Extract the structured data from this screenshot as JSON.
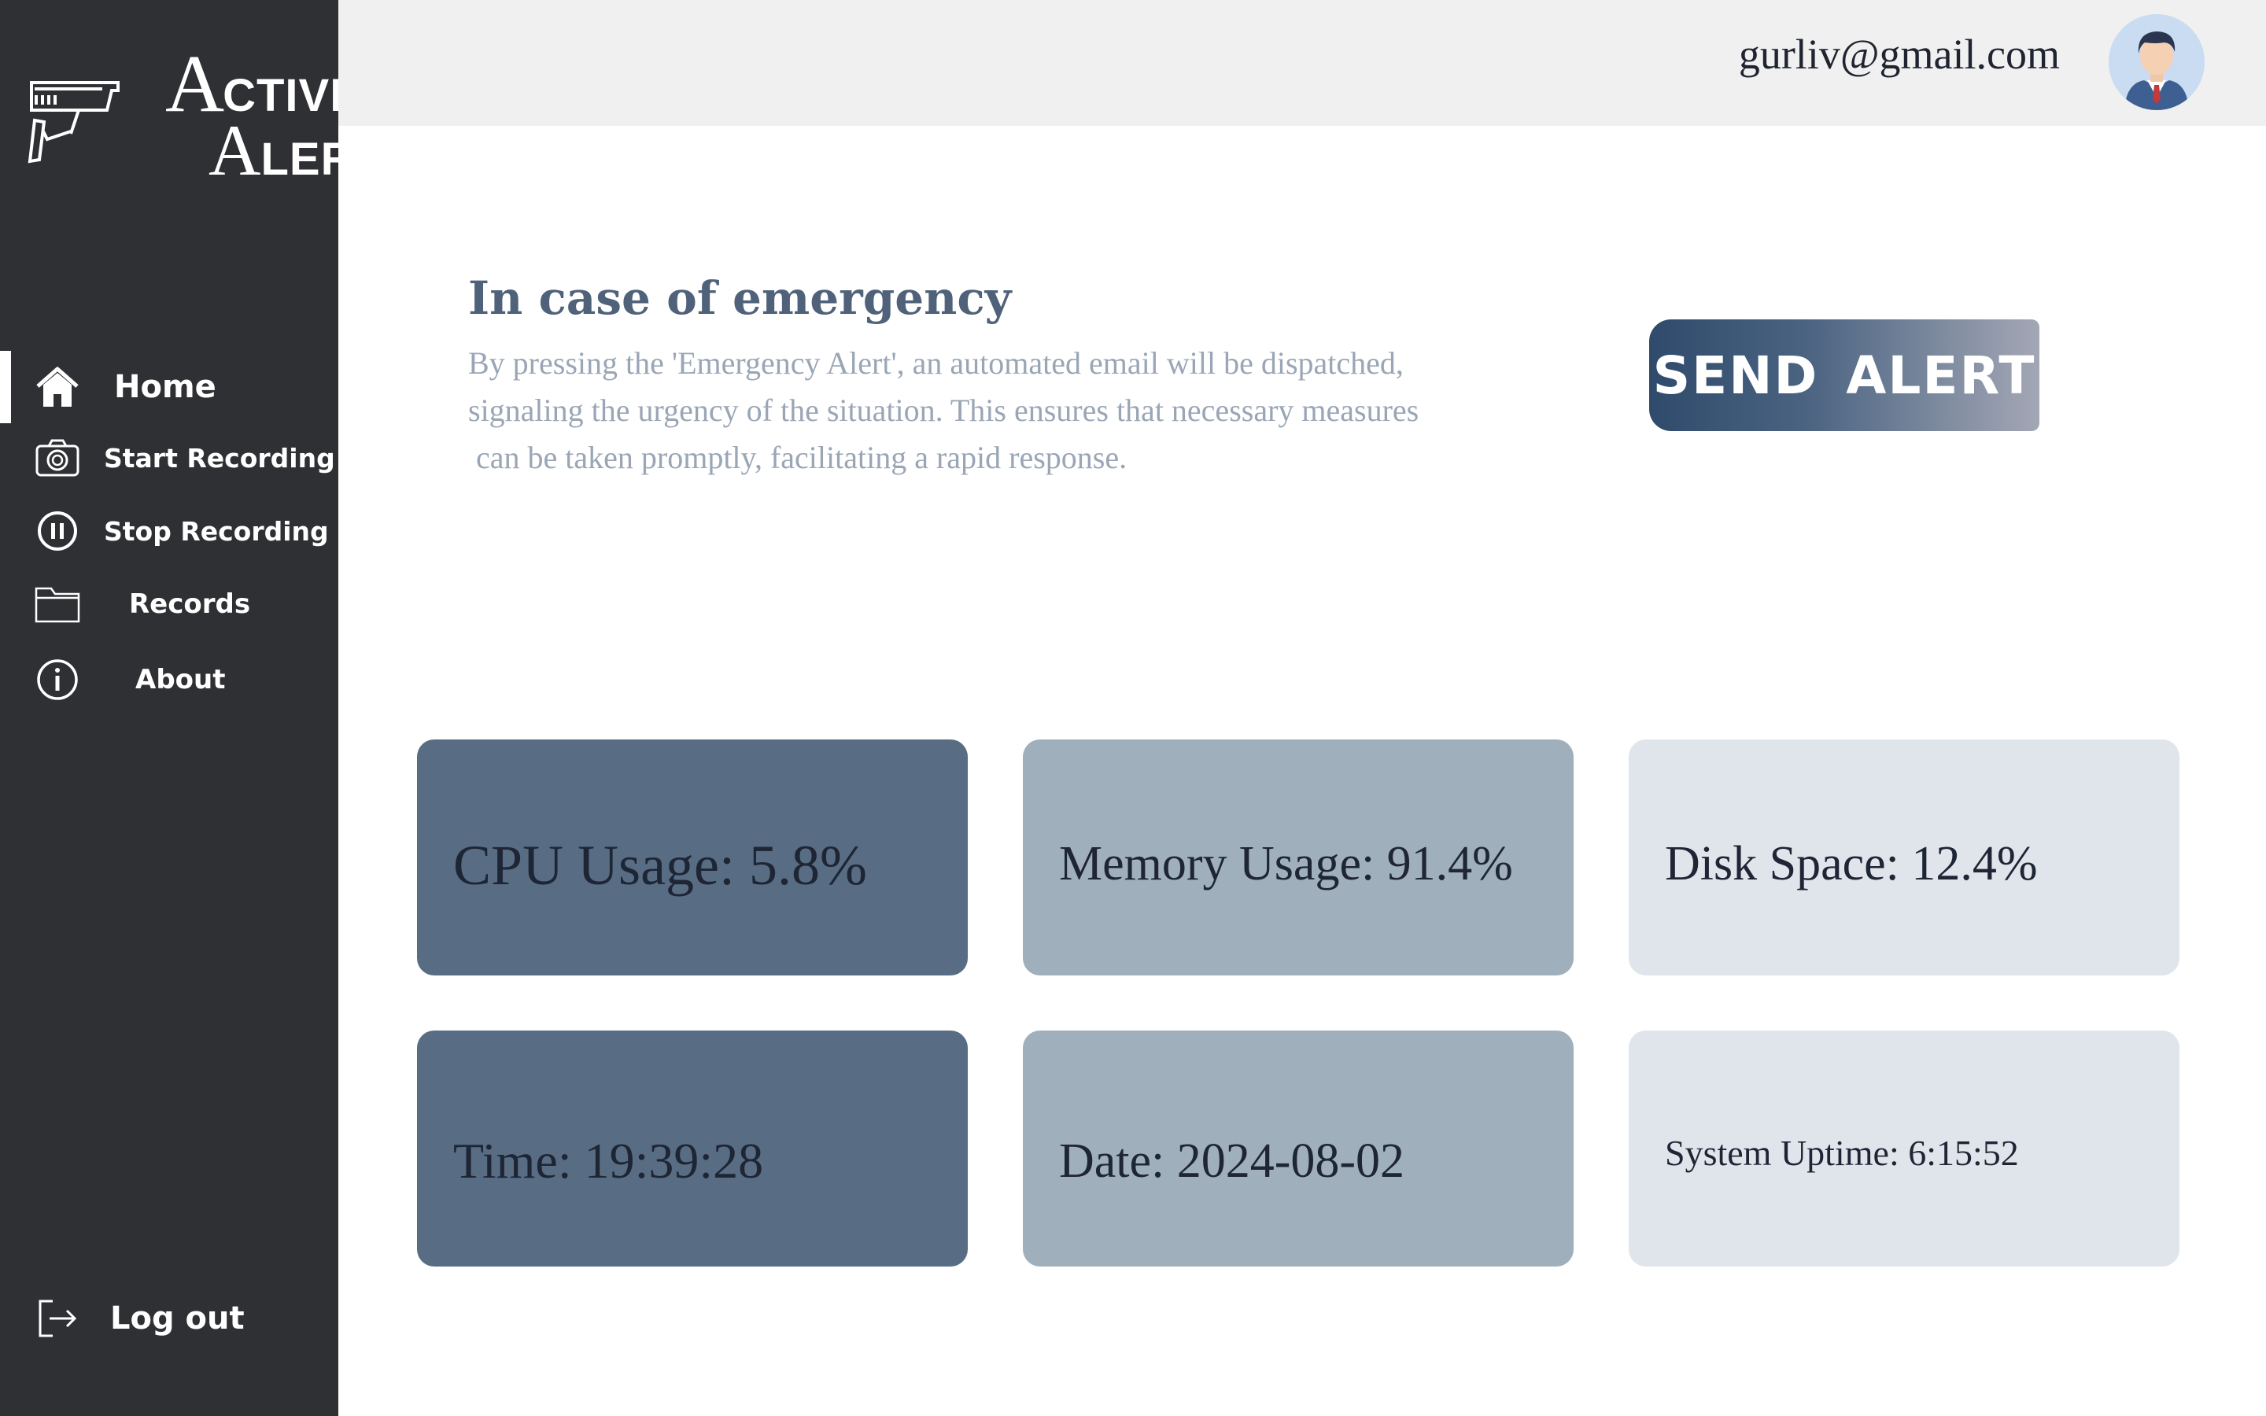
{
  "brand": {
    "line1_first": "A",
    "line1_rest": "CTIVE",
    "line2_first": "A",
    "line2_rest": "LERT"
  },
  "sidebar": {
    "items": [
      {
        "label": "Home",
        "icon": "home-icon",
        "active": true
      },
      {
        "label": "Start Recording",
        "icon": "camera-icon"
      },
      {
        "label": "Stop Recording",
        "icon": "pause-circle-icon"
      },
      {
        "label": "Records",
        "icon": "folder-icon"
      },
      {
        "label": "About",
        "icon": "info-icon"
      }
    ],
    "logout": {
      "label": "Log out",
      "icon": "logout-icon"
    }
  },
  "header": {
    "user_email": "gurliv@gmail.com",
    "avatar_icon": "user-avatar-icon"
  },
  "emergency": {
    "title": "In case of emergency",
    "description_lines": [
      "By pressing the 'Emergency Alert', an automated email will be dispatched,",
      "signaling the urgency of the situation. This ensures that necessary measures",
      " can be taken promptly, facilitating a rapid response."
    ],
    "button_label": "SEND ALERT"
  },
  "stats": {
    "cpu": "CPU Usage: 5.8%",
    "memory": "Memory Usage: 91.4%",
    "disk": "Disk Space: 12.4%",
    "time": "Time: 19:39:28",
    "date": "Date: 2024-08-02",
    "uptime": "System Uptime: 6:15:52"
  },
  "colors": {
    "sidebar_bg": "#2f3033",
    "header_bg": "#f0f0f0",
    "card_dark": "#586d83",
    "card_mid": "#a0afbc",
    "card_light": "#e0e5ec",
    "title_color": "#4f627a"
  }
}
